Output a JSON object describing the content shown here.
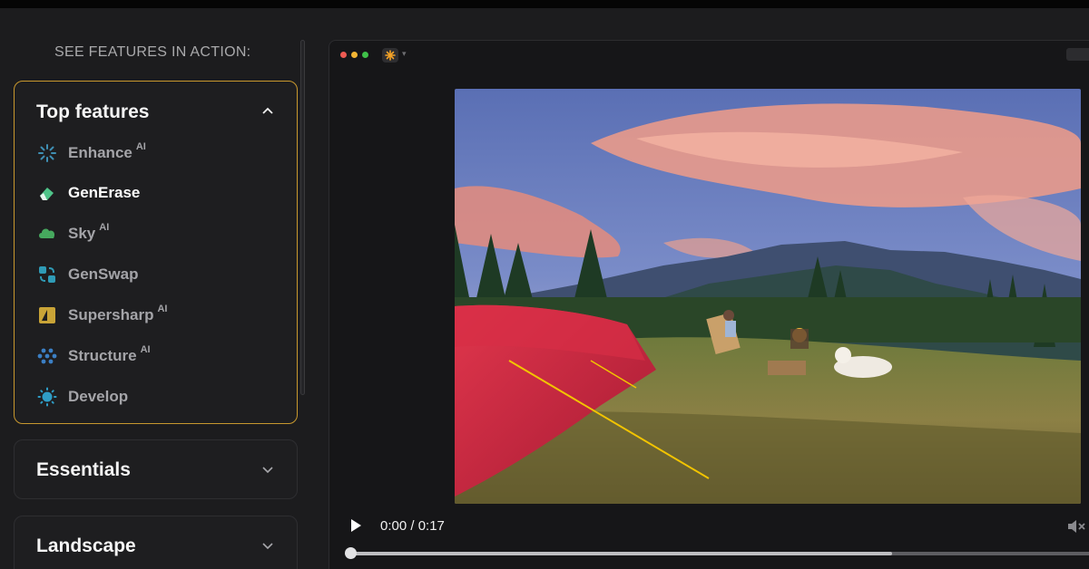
{
  "sidebar": {
    "heading": "SEE FEATURES IN ACTION:",
    "sections": {
      "top_features": {
        "title": "Top features",
        "expanded": true,
        "items": [
          {
            "label": "Enhance",
            "badge": "AI",
            "icon": "enhance-sparkle-icon",
            "active": false
          },
          {
            "label": "GenErase",
            "badge": "",
            "icon": "eraser-icon",
            "active": true
          },
          {
            "label": "Sky",
            "badge": "AI",
            "icon": "cloud-icon",
            "active": false
          },
          {
            "label": "GenSwap",
            "badge": "",
            "icon": "swap-icon",
            "active": false
          },
          {
            "label": "Supersharp",
            "badge": "AI",
            "icon": "sharpen-icon",
            "active": false
          },
          {
            "label": "Structure",
            "badge": "AI",
            "icon": "structure-dots-icon",
            "active": false
          },
          {
            "label": "Develop",
            "badge": "",
            "icon": "sun-develop-icon",
            "active": false
          }
        ]
      },
      "essentials": {
        "title": "Essentials",
        "expanded": false
      },
      "landscape": {
        "title": "Landscape",
        "expanded": false
      }
    }
  },
  "video": {
    "time_display": "0:00 / 0:17",
    "played_fraction": 0,
    "buffered_fraction": 0.72,
    "muted": true
  },
  "colors": {
    "accent_border": "#c8982e",
    "background": "#1c1c1e"
  }
}
